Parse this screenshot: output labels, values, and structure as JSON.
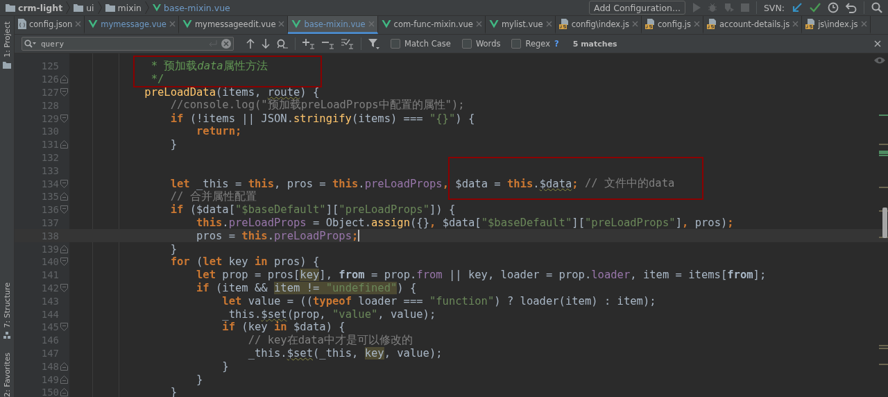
{
  "breadcrumb": [
    {
      "label": "crm-light",
      "kind": "project"
    },
    {
      "label": "ui",
      "kind": "folder"
    },
    {
      "label": "mixin",
      "kind": "folder"
    },
    {
      "label": "base-mixin.vue",
      "kind": "vue"
    }
  ],
  "toolbar": {
    "run_config": "Add Configuration...",
    "vcs_label": "SVN:"
  },
  "tool_windows": [
    {
      "label": "1: Project",
      "kind": "project"
    },
    {
      "label": "7: Structure",
      "kind": "structure"
    },
    {
      "label": "2: Favorites",
      "kind": "favorites"
    }
  ],
  "tabs": [
    {
      "label": "config.json",
      "kind": "json",
      "modified": false,
      "selected": false
    },
    {
      "label": "mymessage.vue",
      "kind": "vue",
      "modified": true,
      "selected": false
    },
    {
      "label": "mymessageedit.vue",
      "kind": "vue",
      "modified": false,
      "selected": false
    },
    {
      "label": "base-mixin.vue",
      "kind": "vue",
      "modified": true,
      "selected": true
    },
    {
      "label": "com-func-mixin.vue",
      "kind": "vue",
      "modified": false,
      "selected": false
    },
    {
      "label": "mylist.vue",
      "kind": "vue",
      "modified": false,
      "selected": false
    },
    {
      "label": "config\\index.js",
      "kind": "js",
      "modified": false,
      "selected": false
    },
    {
      "label": "config.js",
      "kind": "js",
      "modified": false,
      "selected": false
    },
    {
      "label": "account-details.js",
      "kind": "js",
      "modified": false,
      "selected": false
    },
    {
      "label": "js\\index.js",
      "kind": "js",
      "modified": false,
      "selected": false
    }
  ],
  "find_bar": {
    "value": "query",
    "options": [
      {
        "label": "Match Case",
        "checked": false
      },
      {
        "label": "Words",
        "checked": false
      },
      {
        "label": "Regex",
        "checked": false
      }
    ],
    "help": "?",
    "matches": "5 matches"
  },
  "editor": {
    "lines": [
      {
        "number": "125",
        "current": false,
        "tokens": [
          {
            "kind": "doc",
            "text": "     * 预加载"
          },
          {
            "kind": "doc_em",
            "text": "data"
          },
          {
            "kind": "doc",
            "text": "属性方法"
          }
        ]
      },
      {
        "number": "126",
        "current": false,
        "kind": "fold_end",
        "tokens": [
          {
            "kind": "doc",
            "text": "     */"
          }
        ]
      },
      {
        "number": "127",
        "current": false,
        "kind": "fold_start",
        "tokens": [
          {
            "kind": "fn",
            "text": "    preLoadData"
          },
          {
            "kind": "plain",
            "text": "(items, "
          },
          {
            "kind": "plain",
            "text": "route",
            "wavy": true
          },
          {
            "kind": "plain",
            "text": ") {"
          }
        ]
      },
      {
        "number": "128",
        "current": false,
        "tokens": [
          {
            "kind": "cmt",
            "text": "        //console.log(\"预加载preLoadProps中配置的属性\");"
          }
        ]
      },
      {
        "number": "129",
        "current": false,
        "kind": "fold_start",
        "tokens": [
          {
            "kind": "kw",
            "text": "        if"
          },
          {
            "kind": "plain",
            "text": " (!items || JSON."
          },
          {
            "kind": "fn",
            "text": "stringify"
          },
          {
            "kind": "plain",
            "text": "(items) === "
          },
          {
            "kind": "str",
            "text": "\"{}\""
          },
          {
            "kind": "plain",
            "text": ") {"
          }
        ]
      },
      {
        "number": "130",
        "current": false,
        "tokens": [
          {
            "kind": "kw",
            "text": "            return;"
          }
        ]
      },
      {
        "number": "131",
        "current": false,
        "kind": "fold_end",
        "tokens": [
          {
            "kind": "plain",
            "text": "        }"
          }
        ]
      },
      {
        "number": "132",
        "current": false
      },
      {
        "number": "133",
        "current": false
      },
      {
        "number": "134",
        "current": false,
        "kind": "fold_start",
        "tokens": [
          {
            "kind": "kw",
            "text": "        let"
          },
          {
            "kind": "plain",
            "text": " _this = "
          },
          {
            "kind": "kw",
            "text": "this"
          },
          {
            "kind": "plain",
            "text": ", pros = "
          },
          {
            "kind": "kw",
            "text": "this"
          },
          {
            "kind": "plain",
            "text": "."
          },
          {
            "kind": "field",
            "text": "preLoadProps"
          },
          {
            "kind": "kw",
            "text": ", "
          },
          {
            "kind": "plain",
            "text": "$data = "
          },
          {
            "kind": "kw",
            "text": "this"
          },
          {
            "kind": "plain",
            "text": "."
          },
          {
            "kind": "plain",
            "text": "$data",
            "wavy": true
          },
          {
            "kind": "kw",
            "text": ";"
          },
          {
            "kind": "cmt",
            "text": " // 文件中的data"
          }
        ]
      },
      {
        "number": "135",
        "current": false,
        "kind": "fold_end",
        "tokens": [
          {
            "kind": "cmt",
            "text": "        // 合并属性配置"
          }
        ]
      },
      {
        "number": "136",
        "current": false,
        "kind": "fold_start",
        "tokens": [
          {
            "kind": "kw",
            "text": "        if"
          },
          {
            "kind": "plain",
            "text": " ($data["
          },
          {
            "kind": "str",
            "text": "\"$baseDefault\""
          },
          {
            "kind": "plain",
            "text": "]["
          },
          {
            "kind": "str",
            "text": "\"preLoadProps\""
          },
          {
            "kind": "plain",
            "text": "]) {"
          }
        ]
      },
      {
        "number": "137",
        "current": false,
        "tokens": [
          {
            "kind": "kw",
            "text": "            this"
          },
          {
            "kind": "plain",
            "text": "."
          },
          {
            "kind": "field",
            "text": "preLoadProps"
          },
          {
            "kind": "plain",
            "text": " = Object."
          },
          {
            "kind": "fn",
            "text": "assign"
          },
          {
            "kind": "plain",
            "text": "({}"
          },
          {
            "kind": "kw",
            "text": ", "
          },
          {
            "kind": "plain",
            "text": "$data["
          },
          {
            "kind": "str",
            "text": "\"$baseDefault\""
          },
          {
            "kind": "plain",
            "text": "]["
          },
          {
            "kind": "str",
            "text": "\"preLoadProps\""
          },
          {
            "kind": "plain",
            "text": "]"
          },
          {
            "kind": "kw",
            "text": ", "
          },
          {
            "kind": "plain",
            "text": "pros)"
          },
          {
            "kind": "kw",
            "text": ";"
          }
        ]
      },
      {
        "number": "138",
        "current": true,
        "tokens": [
          {
            "kind": "plain",
            "text": "            pros = "
          },
          {
            "kind": "kw",
            "text": "this"
          },
          {
            "kind": "plain",
            "text": "."
          },
          {
            "kind": "field",
            "text": "preLoadProps"
          },
          {
            "kind": "kw",
            "text": ";"
          }
        ]
      },
      {
        "number": "139",
        "current": false,
        "kind": "fold_end",
        "tokens": [
          {
            "kind": "plain",
            "text": "        }"
          }
        ]
      },
      {
        "number": "140",
        "current": false,
        "kind": "fold_start",
        "tokens": [
          {
            "kind": "kw",
            "text": "        for"
          },
          {
            "kind": "plain",
            "text": " ("
          },
          {
            "kind": "kw",
            "text": "let"
          },
          {
            "kind": "plain",
            "text": " key "
          },
          {
            "kind": "kw",
            "text": "in"
          },
          {
            "kind": "plain",
            "text": " pros) {"
          }
        ]
      },
      {
        "number": "141",
        "current": false,
        "tokens": [
          {
            "kind": "kw",
            "text": "            let"
          },
          {
            "kind": "plain",
            "text": " prop = pros["
          },
          {
            "kind": "plain",
            "text": "key",
            "highlighted": true
          },
          {
            "kind": "plain",
            "text": "], "
          },
          {
            "kind": "bold",
            "text": "from"
          },
          {
            "kind": "plain",
            "text": " = prop."
          },
          {
            "kind": "field",
            "text": "from"
          },
          {
            "kind": "plain",
            "text": " || key, loader = prop."
          },
          {
            "kind": "field",
            "text": "loader"
          },
          {
            "kind": "plain",
            "text": ", item = items["
          },
          {
            "kind": "bold",
            "text": "from"
          },
          {
            "kind": "plain",
            "text": "];"
          }
        ]
      },
      {
        "number": "142",
        "current": false,
        "kind": "fold_start",
        "tokens": [
          {
            "kind": "kw",
            "text": "            if"
          },
          {
            "kind": "plain",
            "text": " (item && "
          },
          {
            "kind": "plain",
            "text": "item != ",
            "highlighted": true
          },
          {
            "kind": "str",
            "text": "\"undefined\"",
            "highlighted": true
          },
          {
            "kind": "plain",
            "text": ") {"
          }
        ]
      },
      {
        "number": "143",
        "current": false,
        "tokens": [
          {
            "kind": "kw",
            "text": "                let"
          },
          {
            "kind": "plain",
            "text": " value = (("
          },
          {
            "kind": "kw",
            "text": "typeof"
          },
          {
            "kind": "plain",
            "text": " loader === "
          },
          {
            "kind": "str",
            "text": "\"function\""
          },
          {
            "kind": "plain",
            "text": ") ? loader(item) : item);"
          }
        ]
      },
      {
        "number": "144",
        "current": false,
        "tokens": [
          {
            "kind": "plain",
            "text": "                _this."
          },
          {
            "kind": "plain",
            "text": "$set",
            "wavy": true
          },
          {
            "kind": "plain",
            "text": "(prop, "
          },
          {
            "kind": "str",
            "text": "\"value\""
          },
          {
            "kind": "plain",
            "text": ", value);"
          }
        ]
      },
      {
        "number": "145",
        "current": false,
        "kind": "fold_start",
        "tokens": [
          {
            "kind": "kw",
            "text": "                if"
          },
          {
            "kind": "plain",
            "text": " (key "
          },
          {
            "kind": "kw",
            "text": "in"
          },
          {
            "kind": "plain",
            "text": " $data) {"
          }
        ]
      },
      {
        "number": "146",
        "current": false,
        "tokens": [
          {
            "kind": "cmt",
            "text": "                    // key在data中才是可以修改的"
          }
        ]
      },
      {
        "number": "147",
        "current": false,
        "tokens": [
          {
            "kind": "plain",
            "text": "                    _this."
          },
          {
            "kind": "plain",
            "text": "$set",
            "wavy": true
          },
          {
            "kind": "plain",
            "text": "(_this, "
          },
          {
            "kind": "plain",
            "text": "key",
            "highlighted": true
          },
          {
            "kind": "plain",
            "text": ", value);"
          }
        ]
      },
      {
        "number": "148",
        "current": false,
        "kind": "fold_end",
        "tokens": [
          {
            "kind": "plain",
            "text": "                }"
          }
        ]
      },
      {
        "number": "149",
        "current": false,
        "kind": "fold_end",
        "tokens": [
          {
            "kind": "plain",
            "text": "            }"
          }
        ]
      },
      {
        "number": "150",
        "current": false,
        "kind": "fold_end",
        "tokens": [
          {
            "kind": "plain",
            "text": "        }"
          }
        ]
      }
    ]
  }
}
